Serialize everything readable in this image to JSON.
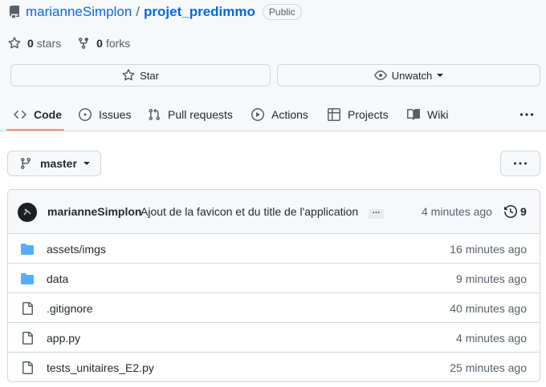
{
  "repo": {
    "owner": "marianneSimplon",
    "separator": "/",
    "name": "projet_predimmo",
    "visibility": "Public"
  },
  "stats": {
    "stars_count": "0",
    "stars_label": "stars",
    "forks_count": "0",
    "forks_label": "forks"
  },
  "actions": {
    "star_label": "Star",
    "watch_label": "Unwatch"
  },
  "tabs": [
    {
      "label": "Code",
      "icon": "code-icon",
      "active": true
    },
    {
      "label": "Issues",
      "icon": "issue-icon"
    },
    {
      "label": "Pull requests",
      "icon": "pull-request-icon"
    },
    {
      "label": "Actions",
      "icon": "play-icon"
    },
    {
      "label": "Projects",
      "icon": "table-icon"
    },
    {
      "label": "Wiki",
      "icon": "book-icon"
    }
  ],
  "branch": {
    "name": "master"
  },
  "latest_commit": {
    "author": "marianneSimplon",
    "message": "Ajout de la favicon et du title de l'application",
    "ellipsis": "…",
    "time": "4 minutes ago",
    "count": "9"
  },
  "files": [
    {
      "name": "assets/imgs",
      "type": "directory",
      "time": "16 minutes ago"
    },
    {
      "name": "data",
      "type": "directory",
      "time": "9 minutes ago"
    },
    {
      "name": ".gitignore",
      "type": "file",
      "time": "40 minutes ago"
    },
    {
      "name": "app.py",
      "type": "file",
      "time": "4 minutes ago"
    },
    {
      "name": "tests_unitaires_E2.py",
      "type": "file",
      "time": "25 minutes ago"
    }
  ],
  "colors": {
    "link": "#0969da",
    "folder": "#54aeff",
    "active_tab_underline": "#fd8c73",
    "muted_text": "#57606a",
    "border": "#d0d7de",
    "header_bg": "#f6f8fa"
  }
}
